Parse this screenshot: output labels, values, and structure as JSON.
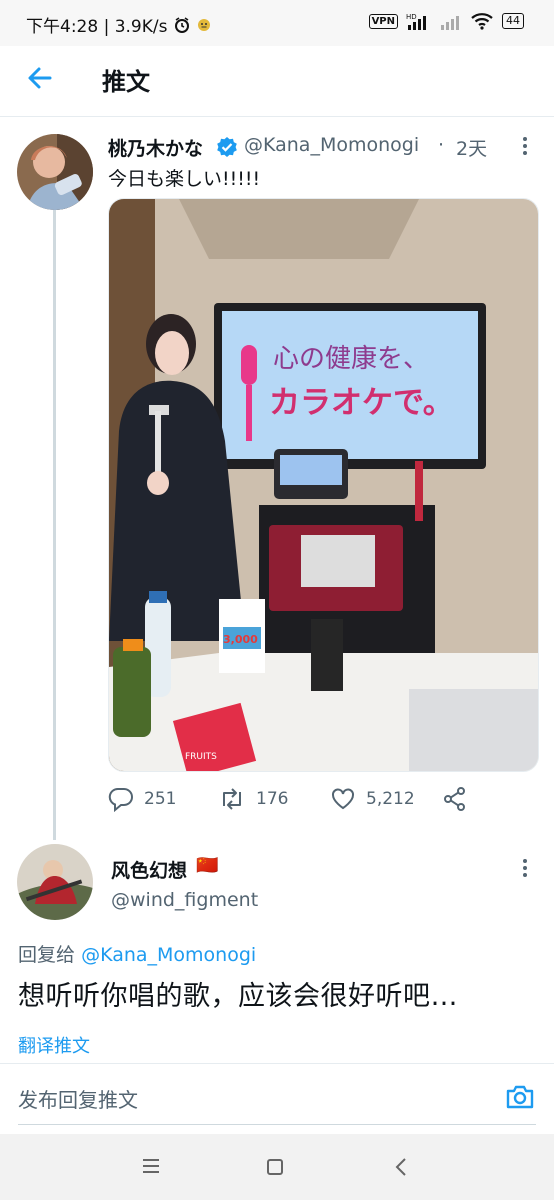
{
  "status_bar": {
    "time_speed": "下午4:28 | 3.9K/s",
    "vpn": "VPN",
    "battery": "44"
  },
  "header": {
    "title": "推文"
  },
  "tweet": {
    "name": "桃乃木かな",
    "handle": "@Kana_Momonogi",
    "sep": "·",
    "time": "2天",
    "text": "今日も楽しい!!!!!",
    "image": {
      "tv_line1": "心の健康を、",
      "tv_line2": "カラオケで。",
      "poster_price": "3,000",
      "bottle_label": "FRUITS"
    },
    "stats": {
      "replies": "251",
      "retweets": "176",
      "likes": "5,212"
    }
  },
  "reply": {
    "name": "风色幻想",
    "flag": "🇨🇳",
    "handle": "@wind_figment",
    "reply_to_label": "回复给",
    "reply_to_handle": "@Kana_Momonogi",
    "text": "想听听你唱的歌，应该会很好听吧…",
    "translate": "翻译推文"
  },
  "composer": {
    "placeholder": "发布回复推文"
  },
  "colors": {
    "accent": "#1d9bf0",
    "text": "#0f1419",
    "muted": "#536471"
  }
}
